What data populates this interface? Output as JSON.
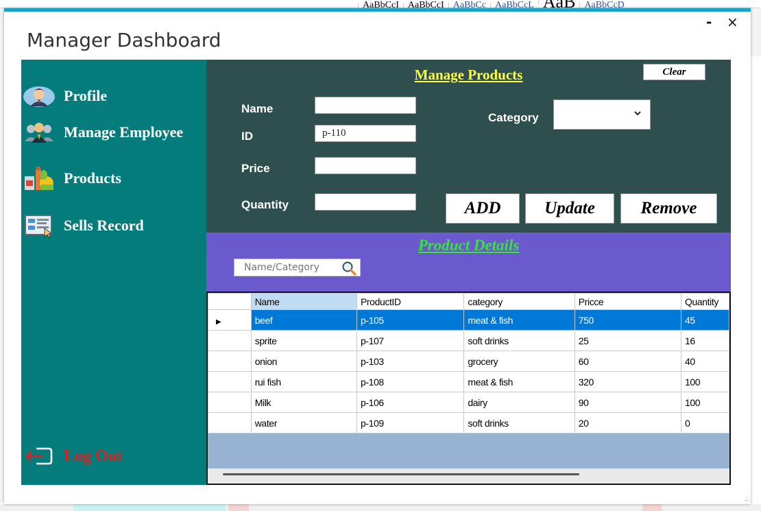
{
  "background": {
    "styles": [
      "AaBbCcI",
      "AaBbCcI",
      "AaBbCc",
      "AaBbCcL",
      "AaB",
      "AaBbCcD"
    ]
  },
  "window": {
    "title": "Manager Dashboard",
    "minimize": "-",
    "close": "×"
  },
  "sidebar": {
    "items": [
      {
        "label": "Profile",
        "icon": "profile-icon"
      },
      {
        "label": "Manage Employee",
        "icon": "employees-icon"
      },
      {
        "label": "Products",
        "icon": "products-icon"
      },
      {
        "label": "Sells Record",
        "icon": "sells-record-icon"
      }
    ],
    "logout": {
      "label": "Log Out",
      "icon": "logout-icon"
    }
  },
  "manage_products": {
    "title": "Manage Products",
    "clear_label": "Clear",
    "name_label": "Name",
    "name_value": "",
    "id_label": "ID",
    "id_value": "p-110",
    "price_label": "Price",
    "price_value": "",
    "quantity_label": "Quantity",
    "quantity_value": "",
    "category_label": "Category",
    "category_value": "",
    "add_label": "ADD",
    "update_label": "Update",
    "remove_label": "Remove"
  },
  "product_details": {
    "title": "Product Details",
    "search_placeholder": "Name/Category"
  },
  "grid": {
    "columns": [
      "Name",
      "ProductID",
      "category",
      "Pricce",
      "Quantity"
    ],
    "rows": [
      [
        "beef",
        "p-105",
        "meat & fish",
        "750",
        "45"
      ],
      [
        "sprite",
        "p-107",
        "soft drinks",
        "25",
        "16"
      ],
      [
        "onion",
        "p-103",
        "grocery",
        "60",
        "40"
      ],
      [
        "rui fish",
        "p-108",
        "meat & fish",
        "320",
        "100"
      ],
      [
        "Milk",
        "p-106",
        "dairy",
        "90",
        "100"
      ],
      [
        "water",
        "p-109",
        "soft drinks",
        "20",
        "0"
      ]
    ],
    "selected_row": 0
  },
  "colors": {
    "sidebar": "#047c7c",
    "form_panel": "#2f4f4f",
    "details_panel": "#6a5acd",
    "manage_title": "#ffff3d",
    "details_title": "#32e832",
    "logout": "#e21f1f",
    "selection": "#0078d7"
  }
}
